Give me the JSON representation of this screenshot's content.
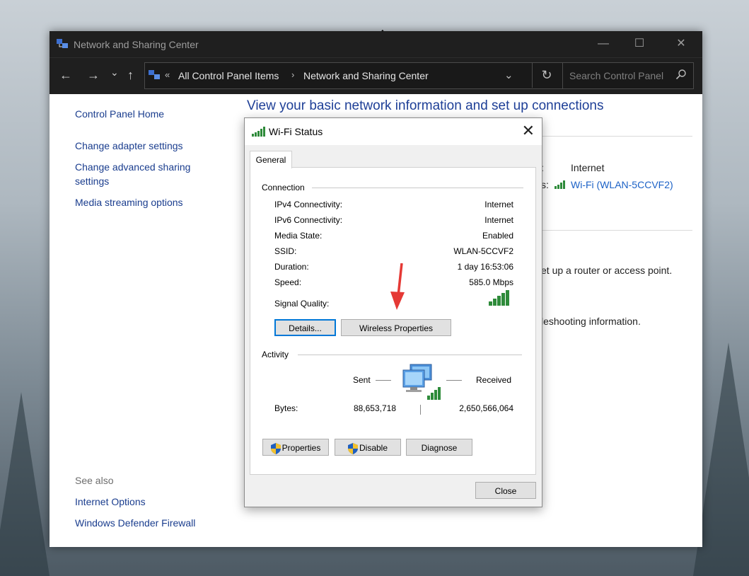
{
  "window": {
    "title": "Network and Sharing Center",
    "controls": {
      "minimize": "—",
      "maximize": "☐",
      "close": "✕"
    }
  },
  "nav": {
    "back": "←",
    "forward": "→",
    "recent": "⌄",
    "up": "↑",
    "breadcrumb_overflow": "«",
    "breadcrumb": [
      "All Control Panel Items",
      "Network and Sharing Center"
    ],
    "breadcrumb_sep": "›",
    "dropdown": "⌄",
    "refresh": "↻",
    "search_placeholder": "Search Control Panel"
  },
  "sidebar": {
    "home": "Control Panel Home",
    "links": [
      "Change adapter settings",
      "Change advanced sharing",
      "settings",
      "Media streaming options"
    ],
    "see_also_header": "See also",
    "see_also": [
      "Internet Options",
      "Windows Defender Firewall"
    ]
  },
  "main": {
    "title": "View your basic network information and set up connections",
    "access_type_colon": ":",
    "access_type_value": "Internet",
    "connections_suffix": "s:",
    "connection_link": "Wi-Fi (WLAN-5CCVF2)",
    "setup_text": "et up a router or access point.",
    "troubleshoot_text": "leshooting information."
  },
  "dialog": {
    "title": "Wi-Fi Status",
    "close": "✕",
    "tab": "General",
    "connection_header": "Connection",
    "rows": [
      {
        "label": "IPv4 Connectivity:",
        "value": "Internet"
      },
      {
        "label": "IPv6 Connectivity:",
        "value": "Internet"
      },
      {
        "label": "Media State:",
        "value": "Enabled"
      },
      {
        "label": "SSID:",
        "value": "WLAN-5CCVF2"
      },
      {
        "label": "Duration:",
        "value": "1 day 16:53:06"
      },
      {
        "label": "Speed:",
        "value": "585.0 Mbps"
      }
    ],
    "signal_label": "Signal Quality:",
    "signal_bars": 5,
    "details_button": "Details...",
    "wireless_properties_button": "Wireless Properties",
    "activity_header": "Activity",
    "sent_label": "Sent",
    "received_label": "Received",
    "bytes_label": "Bytes:",
    "bytes_sent": "88,653,718",
    "bytes_received": "2,650,566,064",
    "properties_button": "Properties",
    "disable_button": "Disable",
    "diagnose_button": "Diagnose",
    "close_button": "Close"
  },
  "colors": {
    "link_blue": "#1a3d8e",
    "wifi_link": "#1b61c6",
    "signal_green": "#2e8b3a",
    "annotation_red": "#e53935"
  }
}
